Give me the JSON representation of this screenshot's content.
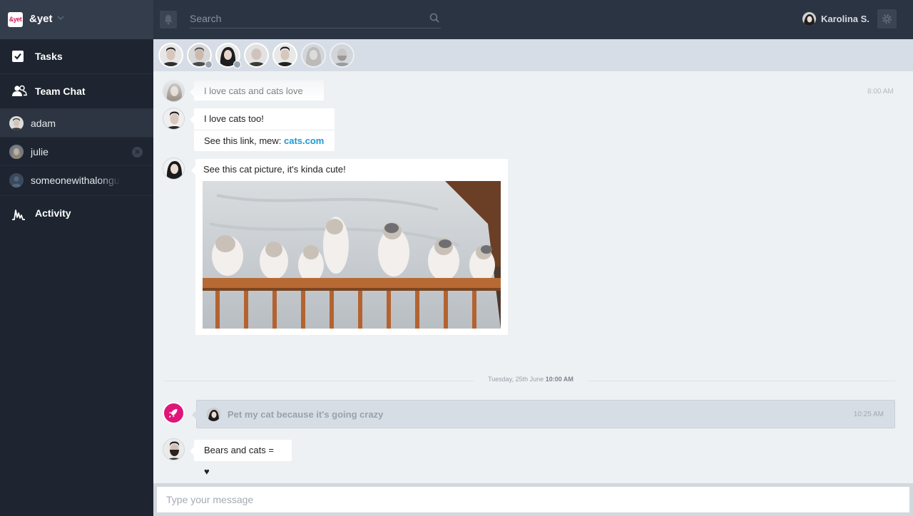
{
  "app": {
    "brand_logo_text": "&yet",
    "brand_name": "&yet"
  },
  "topbar": {
    "search_placeholder": "Search",
    "user_name": "Karolina S."
  },
  "sidebar": {
    "tasks_label": "Tasks",
    "team_chat_label": "Team Chat",
    "chats": [
      {
        "name": "adam",
        "active": true
      },
      {
        "name": "julie",
        "active": false,
        "closable": true
      },
      {
        "name": "someonewithalongusername",
        "active": false
      }
    ],
    "activity_label": "Activity"
  },
  "members": [
    {
      "name": "member-1",
      "faded": false,
      "mobile": false
    },
    {
      "name": "member-2",
      "faded": false,
      "mobile": true
    },
    {
      "name": "member-3",
      "faded": false,
      "mobile": true
    },
    {
      "name": "member-4",
      "faded": false,
      "mobile": false
    },
    {
      "name": "member-5",
      "faded": false,
      "mobile": false
    },
    {
      "name": "member-6",
      "faded": true,
      "mobile": false
    },
    {
      "name": "member-7",
      "faded": true,
      "mobile": false
    }
  ],
  "messages": {
    "m1_text": "I love cats and cats love me!",
    "m1_time": "8:00 AM",
    "m2_line1": "I love cats too!",
    "m2_line2_prefix": "See this link, mew: ",
    "m2_link": "cats.com",
    "m3_text": "See this cat picture, it's kinda cute!",
    "divider_date": "Tuesday, 25th June",
    "divider_time": "10:00 AM",
    "activity_text": "Pet my cat because it's going crazy",
    "activity_time": "10:25 AM",
    "m4_text": "Bears and cats = ♥"
  },
  "composer": {
    "placeholder": "Type your message"
  },
  "colors": {
    "sidebar_bg": "#1e2530",
    "topbar_bg": "#2b3442",
    "accent_link": "#1a9bd7",
    "activity_accent": "#e0157a"
  }
}
